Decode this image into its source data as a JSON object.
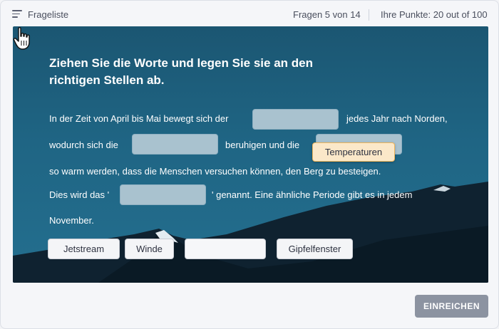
{
  "header": {
    "question_list_label": "Frageliste",
    "question_counter": "Fragen 5 von 14",
    "points_label": "Ihre Punkte: 20 out of 100"
  },
  "question": {
    "title": "Ziehen Sie die Worte und legen Sie sie an den richtigen Stellen ab.",
    "line1_a": "In der Zeit von April bis Mai bewegt sich der",
    "line1_b": "jedes Jahr nach Norden,",
    "line2_a": "wodurch sich die",
    "line2_b": "beruhigen und die",
    "line3": "so warm werden, dass die Menschen versuchen können, den Berg zu besteigen.",
    "line4_a": "Dies wird das '",
    "line4_b": "' genannt. Eine ähnliche Periode gibt es in jedem",
    "line5": "November."
  },
  "word_bank": [
    "Jetstream",
    "Winde",
    "",
    "Gipfelfenster"
  ],
  "dragging_word": "Temperaturen",
  "submit_label": "EINREICHEN",
  "colors": {
    "accent": "#f0b65a",
    "stage_bg": "#1f6584",
    "submit_bg": "#8c93a1"
  },
  "icons": {
    "question_list": "list-icon",
    "cursor": "hand-pointer-icon"
  }
}
